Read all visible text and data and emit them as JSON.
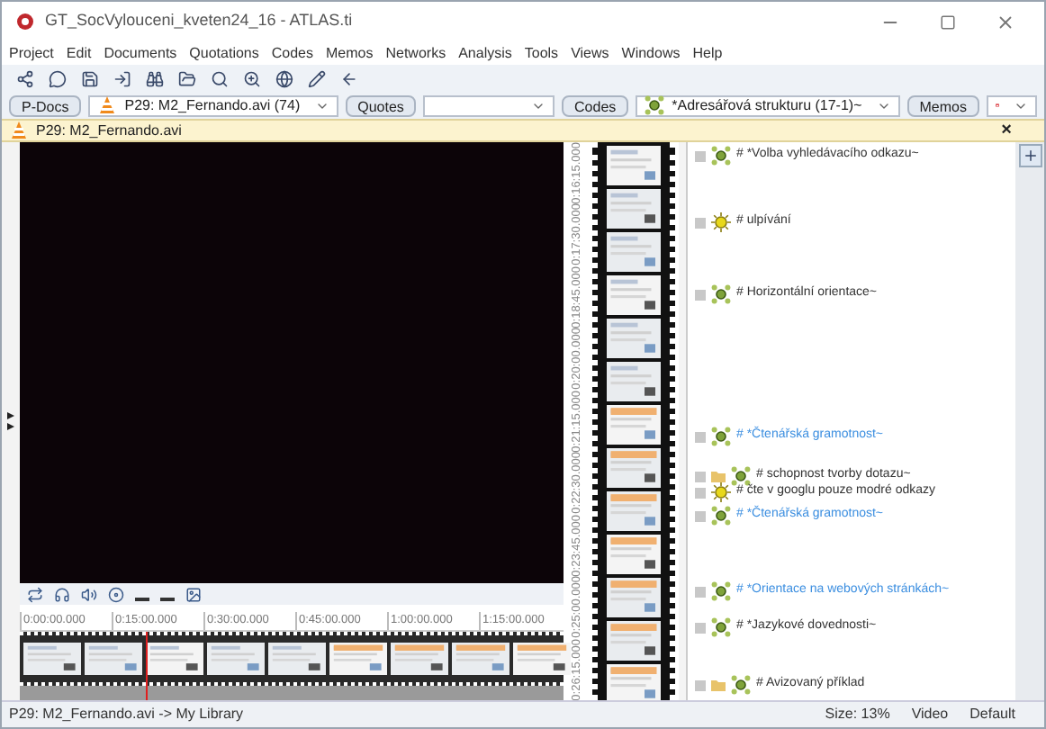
{
  "window": {
    "title": "GT_SocVylouceni_kveten24_16 - ATLAS.ti"
  },
  "menu": [
    "Project",
    "Edit",
    "Documents",
    "Quotations",
    "Codes",
    "Memos",
    "Networks",
    "Analysis",
    "Tools",
    "Views",
    "Windows",
    "Help"
  ],
  "selectors": [
    {
      "button": "P-Docs",
      "value": "P29: M2_Fernando.avi (74)",
      "kind": "doc"
    },
    {
      "button": "Quotes",
      "kind": "empty"
    },
    {
      "button": "Codes",
      "value": "*Adresářová strukturu (17-1)~",
      "kind": "code"
    },
    {
      "button": "Memos",
      "kind": "memo"
    }
  ],
  "document": {
    "title": "P29: M2_Fernando.avi",
    "close": "×"
  },
  "timeline": {
    "ticks": [
      "0:00:00.000",
      "0:15:00.000",
      "0:30:00.000",
      "0:45:00.000",
      "1:00:00.000",
      "1:15:00.000"
    ]
  },
  "filmstrip": {
    "ticks": [
      "0:16:15.000",
      "0:17:30.000",
      "0:18:45.000",
      "0:20:00.000",
      "0:21:15.000",
      "0:22:30.000",
      "0:23:45.000",
      "0:25:00.000",
      "0:26:15.000"
    ]
  },
  "codes": [
    {
      "label": "# *Volba vyhledávacího odkazu~",
      "kind": "code",
      "color": "#333333",
      "in_folder": false
    },
    {
      "label": "# ulpívání",
      "kind": "yellow",
      "color": "#333333",
      "in_folder": false
    },
    {
      "label": "# Horizontální orientace~",
      "kind": "code",
      "color": "#333333",
      "in_folder": false
    },
    {
      "label": "# *Čtenářská gramotnost~",
      "kind": "code",
      "color": "#3b8ee0",
      "in_folder": false
    },
    {
      "label": "# schopnost tvorby dotazu~",
      "kind": "code",
      "color": "#333333",
      "in_folder": true
    },
    {
      "label": "# čte v googlu pouze modré odkazy",
      "kind": "yellow",
      "color": "#333333",
      "in_folder": false
    },
    {
      "label": "# *Čtenářská gramotnost~",
      "kind": "code",
      "color": "#3b8ee0",
      "in_folder": false
    },
    {
      "label": "# *Orientace na webových stránkách~",
      "kind": "code",
      "color": "#3b8ee0",
      "in_folder": false
    },
    {
      "label": "# *Jazykové dovednosti~",
      "kind": "code",
      "color": "#333333",
      "in_folder": false
    },
    {
      "label": "# Avizovaný příklad",
      "kind": "code",
      "color": "#333333",
      "in_folder": true
    }
  ],
  "status_bar": {
    "path": "P29: M2_Fernando.avi -> My Library",
    "size": "Size: 13%",
    "mode": "Video",
    "layout": "Default"
  }
}
